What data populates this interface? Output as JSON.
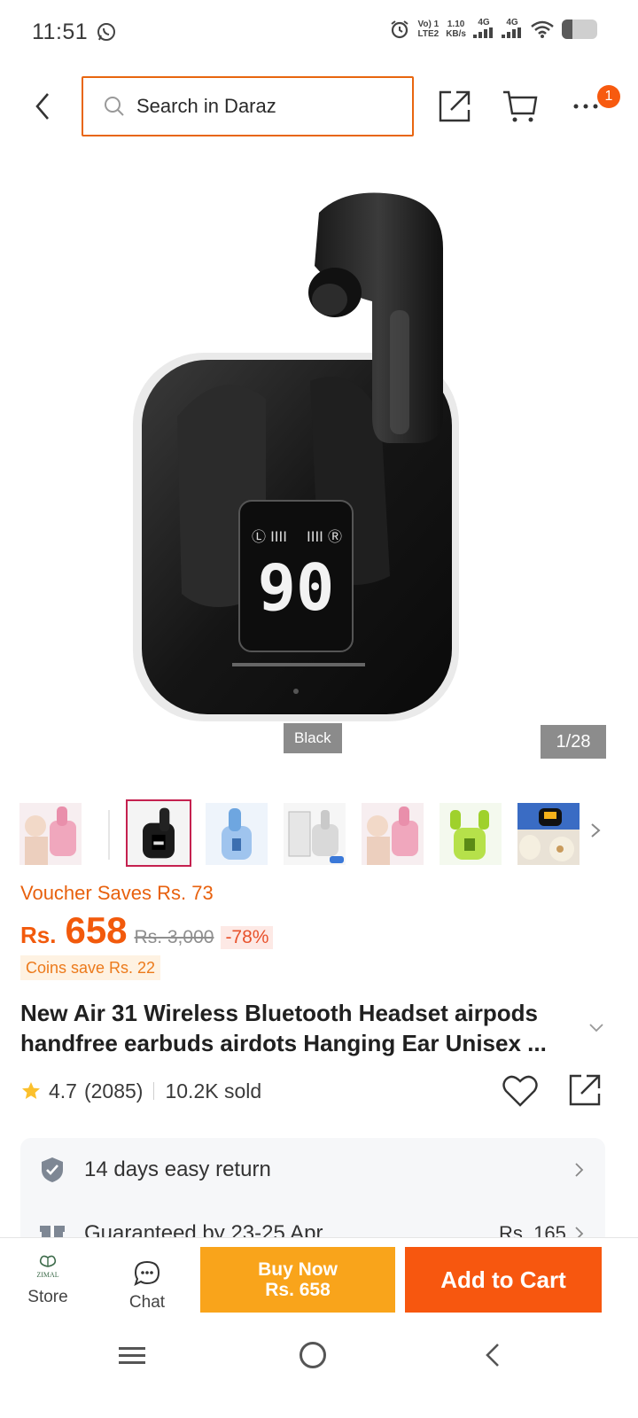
{
  "status_bar": {
    "time": "11:51",
    "network_1": "Vo) 1",
    "network_1_sub": "LTE2",
    "speed": "1.10",
    "speed_unit": "KB/s",
    "signal_1": "4G",
    "signal_2": "4G",
    "battery_level": 0.3
  },
  "header": {
    "search_placeholder": "Search in Daraz",
    "more_badge": "1"
  },
  "gallery": {
    "variant_label": "Black",
    "page_indicator": "1/28",
    "display_text": "90"
  },
  "price": {
    "voucher_text": "Voucher Saves Rs. 73",
    "currency": "Rs.",
    "current": "658",
    "original": "Rs. 3,000",
    "discount": "-78%",
    "coins_text": "Coins save Rs. 22"
  },
  "product": {
    "title": "New Air 31 Wireless Bluetooth Headset airpods handfree earbuds airdots Hanging Ear Unisex ...",
    "rating": "4.7",
    "reviews": "(2085)",
    "sold": "10.2K sold"
  },
  "services": {
    "return_text": "14 days easy return",
    "delivery_text": "Guaranteed by 23-25 Apr",
    "delivery_fee": "Rs. 165"
  },
  "action_bar": {
    "store_logo_text": "ZIMAL",
    "store_label": "Store",
    "chat_label": "Chat",
    "buy_now_label": "Buy Now",
    "buy_now_price": "Rs. 658",
    "add_to_cart_label": "Add to Cart"
  },
  "colors": {
    "accent": "#f7570f",
    "buy_now": "#f9a41b",
    "price": "#f25a0c",
    "search_border": "#e8660f"
  }
}
